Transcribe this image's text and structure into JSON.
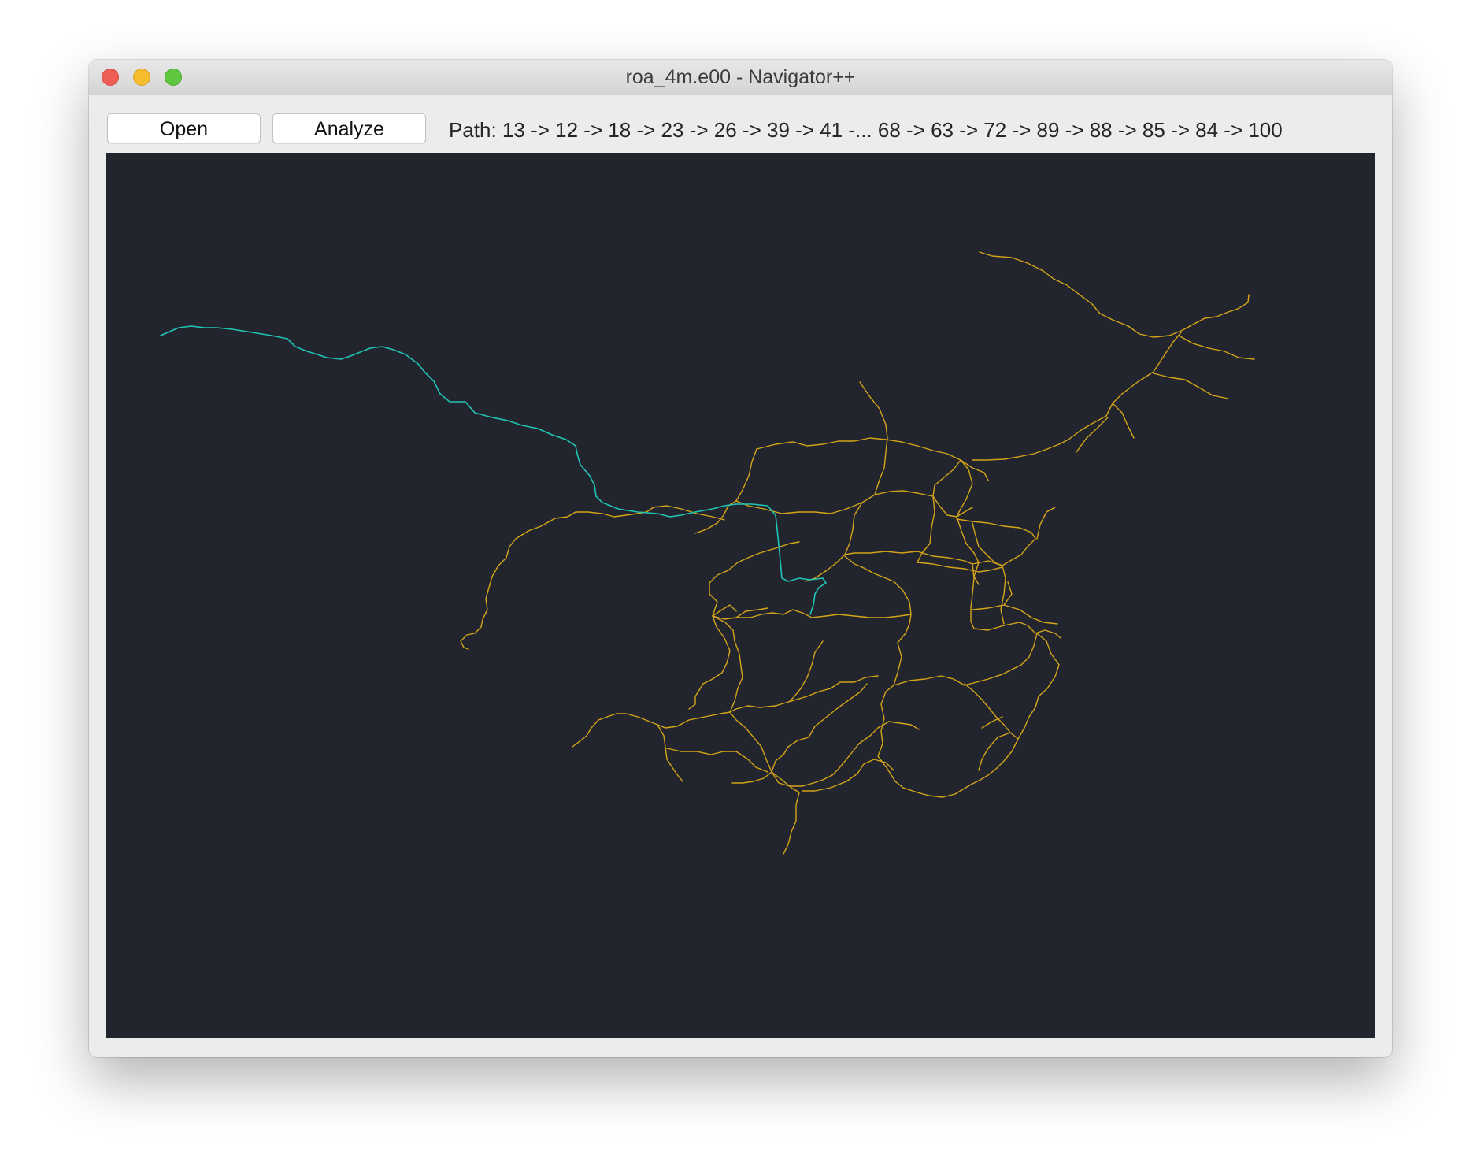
{
  "window": {
    "title": "roa_4m.e00 - Navigator++"
  },
  "toolbar": {
    "open_label": "Open",
    "analyze_label": "Analyze",
    "path_text": "Path: 13 -> 12 -> 18 -> 23 -> 26 -> 39 -> 41 -... 68 -> 63 -> 72 -> 89 -> 88 -> 85 -> 84 -> 100"
  },
  "map": {
    "background_color": "#22252e",
    "road_color": "#d4a517",
    "path_color": "#1fc4b4"
  }
}
